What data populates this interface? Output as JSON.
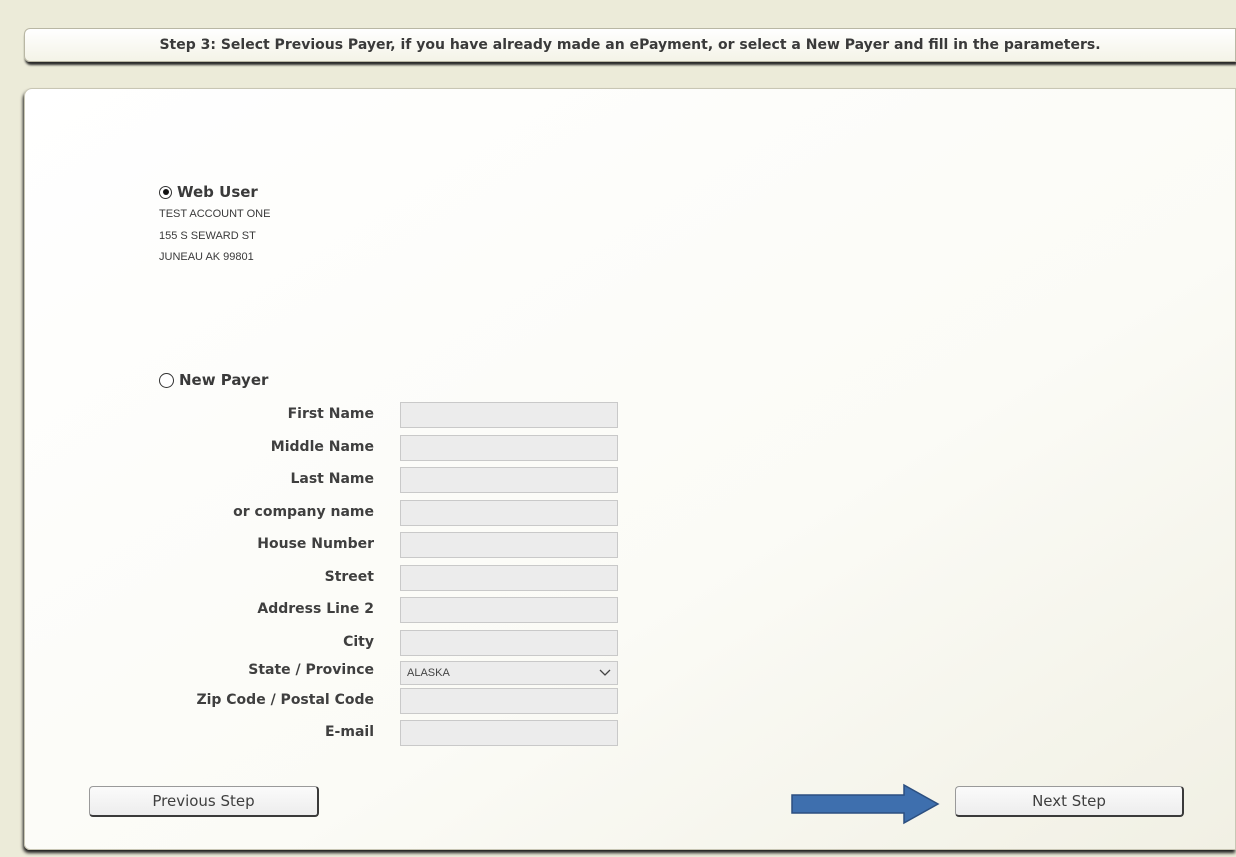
{
  "header": {
    "step_text": "Step 3: Select Previous Payer, if you have already made an ePayment, or select a New Payer and fill in the parameters."
  },
  "web_user": {
    "label": "Web User",
    "selected": true,
    "name": "TEST ACCOUNT ONE",
    "address1": "155 S SEWARD ST",
    "address2": "JUNEAU AK 99801"
  },
  "new_payer": {
    "label": "New Payer",
    "selected": false
  },
  "fields": {
    "first_name": {
      "label": "First Name",
      "value": ""
    },
    "middle_name": {
      "label": "Middle Name",
      "value": ""
    },
    "last_name": {
      "label": "Last Name",
      "value": ""
    },
    "company_name": {
      "label": "or company name",
      "value": ""
    },
    "house_number": {
      "label": "House Number",
      "value": ""
    },
    "street": {
      "label": "Street",
      "value": ""
    },
    "address_line_2": {
      "label": "Address Line 2",
      "value": ""
    },
    "city": {
      "label": "City",
      "value": ""
    },
    "state": {
      "label": "State / Province",
      "value": "ALASKA"
    },
    "zip": {
      "label": "Zip Code / Postal Code",
      "value": ""
    },
    "email": {
      "label": "E-mail",
      "value": ""
    }
  },
  "buttons": {
    "previous": "Previous Step",
    "next": "Next Step"
  },
  "annotation": {
    "arrow_color": "#3e6fae",
    "arrow_icon": "right-arrow-icon"
  }
}
